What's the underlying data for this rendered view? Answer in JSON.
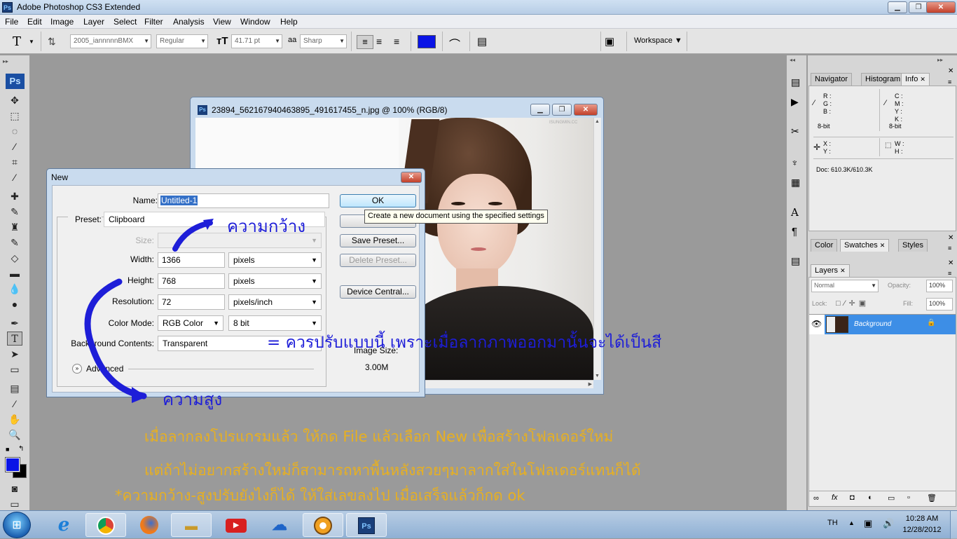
{
  "app": {
    "title": "Adobe Photoshop CS3 Extended",
    "logo": "Ps"
  },
  "menu": [
    "File",
    "Edit",
    "Image",
    "Layer",
    "Select",
    "Filter",
    "Analysis",
    "View",
    "Window",
    "Help"
  ],
  "options": {
    "tool_glyph": "T",
    "font_family": "2005_iannnnnBMX",
    "font_style": "Regular",
    "font_size": "41.71 pt",
    "aa_label": "a",
    "aa_mode": "Sharp",
    "color": "#0a14e6",
    "workspace": "Workspace"
  },
  "document": {
    "title": "23894_562167940463895_491617455_n.jpg @ 100% (RGB/8)",
    "watermark": "ISUNGMIN.CC"
  },
  "dialog": {
    "title": "New",
    "name_label": "Name:",
    "name_value": "Untitled-1",
    "preset_label": "Preset:",
    "preset_value": "Clipboard",
    "size_label": "Size:",
    "width_label": "Width:",
    "width_value": "1366",
    "width_unit": "pixels",
    "height_label": "Height:",
    "height_value": "768",
    "height_unit": "pixels",
    "resolution_label": "Resolution:",
    "resolution_value": "72",
    "resolution_unit": "pixels/inch",
    "color_mode_label": "Color Mode:",
    "color_mode_value": "RGB Color",
    "color_depth": "8 bit",
    "bg_label": "Background Contents:",
    "bg_value": "Transparent",
    "advanced": "Advanced",
    "image_size_label": "Image Size:",
    "image_size_value": "3.00M",
    "ok": "OK",
    "save_preset": "Save Preset...",
    "delete_preset": "Delete Preset...",
    "device_central": "Device Central...",
    "tooltip": "Create a new document using the specified settings"
  },
  "panels": {
    "info_tabs": [
      "Navigator",
      "Histogram",
      "Info"
    ],
    "info": {
      "r": "R :",
      "g": "G :",
      "b": "B :",
      "c": "C :",
      "m": "M :",
      "y": "Y :",
      "k": "K :",
      "bit_left": "8-bit",
      "bit_right": "8-bit",
      "x": "X :",
      "yc": "Y :",
      "w": "W :",
      "h": "H :",
      "doc": "Doc: 610.3K/610.3K"
    },
    "color_tabs": [
      "Color",
      "Swatches",
      "Styles"
    ],
    "layers_tab": "Layers",
    "blend": "Normal",
    "opacity_label": "Opacity:",
    "opacity": "100%",
    "lock_label": "Lock:",
    "fill_label": "Fill:",
    "fill": "100%",
    "layer_name": "Background"
  },
  "annotations": {
    "width_note": "ความกว้าง",
    "height_note": "ความสูง",
    "adjust_note": "= ควรปรับแบบนี้ เพราะเมื่อลากภาพออกมานั้นจะได้เป็นสี",
    "line1": "เมื่อลากลงโปรแกรมแล้ว ให้กด File แล้วเลือก New เพื่อสร้างโฟลเดอร์ใหม่",
    "line2": "แต่ถ้าไม่อยากสร้างใหม่ก็สามารถหาพื้นหลังสวยๆมาลากใส่ในโฟลเดอร์แทนก็ได้",
    "line3": "*ความกว้าง-สูงปรับยังไงก็ได้ ให้ใส่เลขลงไป เมื่อเสร็จแล้วก็กด ok"
  },
  "taskbar": {
    "lang": "TH",
    "time": "10:28 AM",
    "date": "12/28/2012"
  }
}
